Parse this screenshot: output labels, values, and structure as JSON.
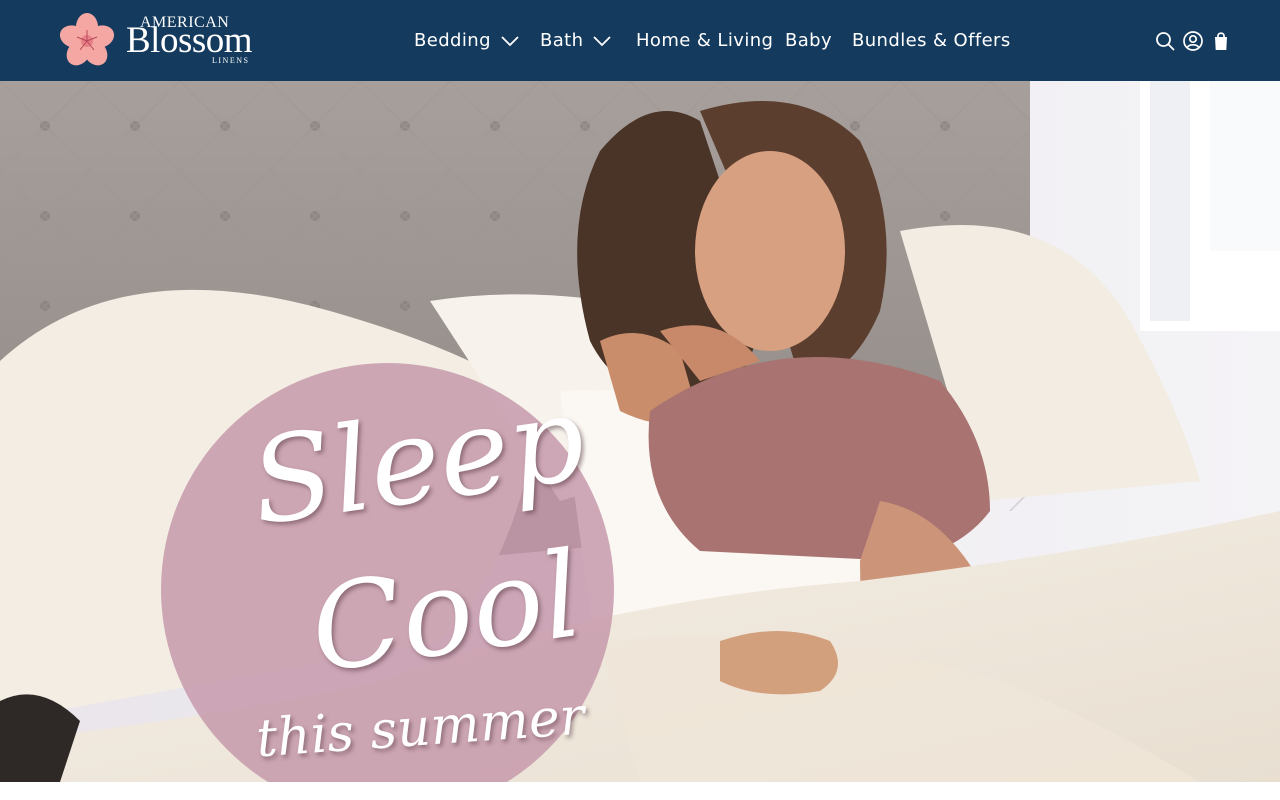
{
  "brand": {
    "line1": "AMERICAN",
    "line2": "Blossom",
    "line3": "LINENS",
    "logo_icon": "cherry-blossom-icon",
    "flower_color": "#f4a7a3",
    "header_color": "#143a5e"
  },
  "nav": {
    "items": [
      {
        "label": "Bedding",
        "has_dropdown": true
      },
      {
        "label": "Bath",
        "has_dropdown": true
      },
      {
        "label": "Home & Living",
        "has_dropdown": false
      },
      {
        "label": "Baby",
        "has_dropdown": false
      },
      {
        "label": "Bundles & Offers",
        "has_dropdown": false
      }
    ]
  },
  "header_icons": [
    "search-icon",
    "account-icon",
    "cart-icon"
  ],
  "hero": {
    "line1": "Sleep",
    "line2": "Cool",
    "line3": "this summer",
    "badge_color": "#c496aa"
  }
}
